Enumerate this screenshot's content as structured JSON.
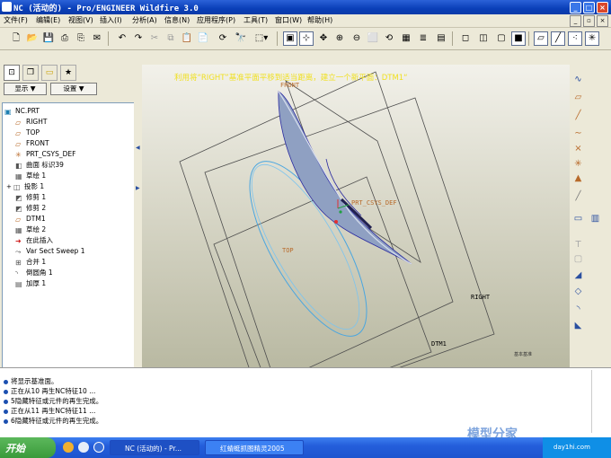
{
  "window": {
    "title": "NC (活动的) - Pro/ENGINEER Wildfire 3.0"
  },
  "menu": [
    "文件(F)",
    "编辑(E)",
    "视图(V)",
    "插入(I)",
    "分析(A)",
    "信息(N)",
    "应用程序(P)",
    "工具(T)",
    "窗口(W)",
    "帮助(H)"
  ],
  "left_panel": {
    "show_label": "显示 ▼",
    "settings_label": "设置 ▼"
  },
  "model_tree": [
    {
      "label": "NC.PRT",
      "icon": "part-icon"
    },
    {
      "label": "RIGHT",
      "icon": "datum-plane-icon"
    },
    {
      "label": "TOP",
      "icon": "datum-plane-icon"
    },
    {
      "label": "FRONT",
      "icon": "datum-plane-icon"
    },
    {
      "label": "PRT_CSYS_DEF",
      "icon": "csys-icon"
    },
    {
      "label": "曲面 标识39",
      "icon": "surface-icon"
    },
    {
      "label": "草绘 1",
      "icon": "sketch-icon"
    },
    {
      "label": "投影 1",
      "icon": "projection-icon",
      "expand": "+"
    },
    {
      "label": "修剪 1",
      "icon": "trim-icon"
    },
    {
      "label": "修剪 2",
      "icon": "trim-icon"
    },
    {
      "label": "DTM1",
      "icon": "datum-plane-icon"
    },
    {
      "label": "草绘 2",
      "icon": "sketch-icon"
    },
    {
      "label": "在此插入",
      "icon": "insert-here-icon"
    },
    {
      "label": "Var Sect Sweep 1",
      "icon": "sweep-icon"
    },
    {
      "label": "合并 1",
      "icon": "merge-icon"
    },
    {
      "label": "倒圆角 1",
      "icon": "round-icon"
    },
    {
      "label": "加厚 1",
      "icon": "thicken-icon"
    }
  ],
  "viewport": {
    "caption": "利用将“RIGHT”基准平面平移到适当距离，建立一个新平面：DTM1“",
    "labels": {
      "front": "FRONT",
      "csys": "PRT_CSYS_DEF",
      "top": "TOP",
      "right": "RIGHT",
      "dtm1": "DTM1",
      "small": "基本基准"
    }
  },
  "messages": [
    "将显示基准面。",
    "正在从10 再生NC特征10 ...",
    "5隐藏特征或元件的再生完成。",
    "正在从11 再生NC特征11 ...",
    "6隐藏特征或元件的再生完成。"
  ],
  "taskbar": {
    "start": "开始",
    "tasks": [
      "NC (活动的) - Pr...",
      "红蜻蜓抓图精灵2005"
    ],
    "watermark": "模型分家",
    "tray_text": "day1hi.com"
  },
  "colors": {
    "titlebar": "#0a3fb8",
    "caption": "#f0e020",
    "surface": "#8fa0c2",
    "datum_plane": "#4d4d4d",
    "datum_label": "#b86a2a",
    "sketch": "#4aa6e0"
  }
}
